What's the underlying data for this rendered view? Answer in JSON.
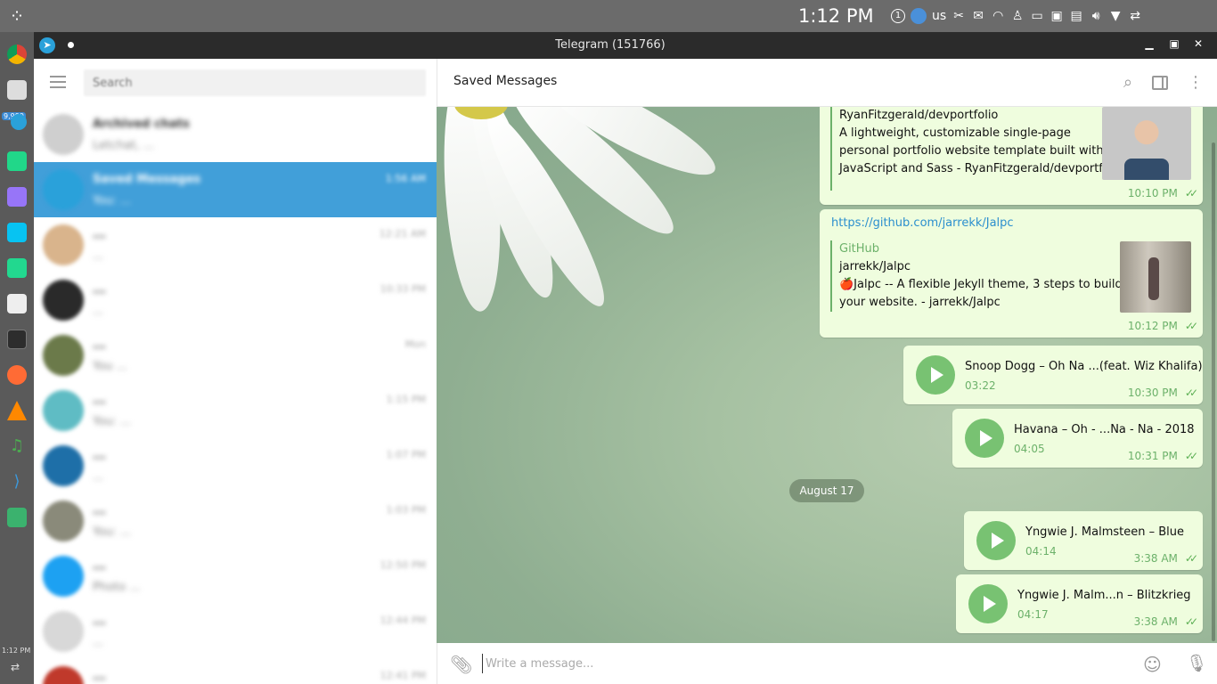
{
  "system": {
    "clock": "1:12 PM",
    "keyboard": "us",
    "tray_badge": "1",
    "launcher_badge": "9,999",
    "launcher_clock": "1:12 PM"
  },
  "window": {
    "title": "Telegram (151766)"
  },
  "sidebar": {
    "search_placeholder": "Search",
    "chats": [
      {
        "name": "Archived chats",
        "preview": "Letchat, ...",
        "time": "",
        "badge": ""
      },
      {
        "name": "Saved Messages",
        "preview": "You: ...",
        "time": "1:56 AM",
        "badge": ""
      },
      {
        "name": "...",
        "preview": "...",
        "time": "12:21 AM",
        "badge": ""
      },
      {
        "name": "...",
        "preview": "...",
        "time": "10:33 PM",
        "badge": ""
      },
      {
        "name": "...",
        "preview": "You ...",
        "time": "Mon",
        "badge": ""
      },
      {
        "name": "...",
        "preview": "You: ...",
        "time": "1:15 PM",
        "badge": ""
      },
      {
        "name": "...",
        "preview": "...",
        "time": "1:07 PM",
        "badge": ""
      },
      {
        "name": "...",
        "preview": "You: ...",
        "time": "1:03 PM",
        "badge": ""
      },
      {
        "name": "...",
        "preview": "Photo ...",
        "time": "12:50 PM",
        "badge": ""
      },
      {
        "name": "...",
        "preview": "...",
        "time": "12:44 PM",
        "badge": ""
      },
      {
        "name": "...",
        "preview": "...",
        "time": "12:41 PM",
        "badge": ""
      }
    ]
  },
  "chat": {
    "title": "Saved Messages",
    "messages": [
      {
        "type": "link_preview",
        "preview_title": "RyanFitzgerald/devportfolio",
        "preview_text_1": "A lightweight, customizable single-page",
        "preview_text_2": "personal portfolio website template built with",
        "preview_text_3": "JavaScript and Sass - RyanFitzgerald/devportf...",
        "time": "10:10 PM"
      },
      {
        "type": "link_preview",
        "url": "https://github.com/jarrekk/Jalpc",
        "site": "GitHub",
        "preview_title": "jarrekk/Jalpc",
        "preview_text_1": "🍎Jalpc -- A flexible Jekyll theme, 3 steps to build",
        "preview_text_2": "your website.  - jarrekk/Jalpc",
        "time": "10:12 PM"
      },
      {
        "type": "audio",
        "title": "Snoop Dogg – Oh Na ...(feat. Wiz Khalifa)",
        "duration": "03:22",
        "time": "10:30 PM"
      },
      {
        "type": "audio",
        "title": "Havana – Oh - ...Na - Na - 2018",
        "duration": "04:05",
        "time": "10:31 PM"
      },
      {
        "type": "date",
        "label": "August 17"
      },
      {
        "type": "audio",
        "title": "Yngwie J. Malmsteen – Blue",
        "duration": "04:14",
        "time": "3:38 AM"
      },
      {
        "type": "audio",
        "title": "Yngwie J. Malm...n – Blitzkrieg",
        "duration": "04:17",
        "time": "3:38 AM"
      }
    ]
  },
  "composer": {
    "placeholder": "Write a message..."
  },
  "colors": {
    "accent": "#419fd9",
    "bubble": "#effdde",
    "read_check": "#5eb055"
  },
  "icons": [
    "menu-icon",
    "search-icon",
    "sidebar-toggle-icon",
    "more-icon",
    "attach-icon",
    "emoji-icon",
    "mic-icon",
    "play-icon",
    "double-check-icon"
  ]
}
